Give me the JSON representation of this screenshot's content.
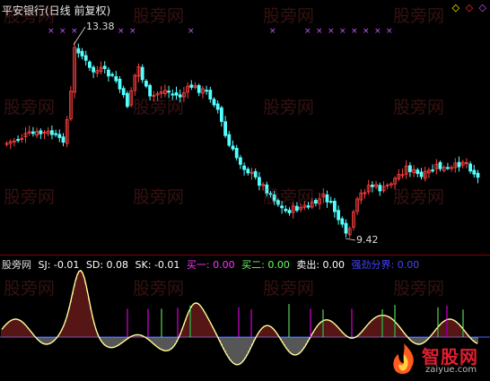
{
  "header": {
    "title": "平安银行(日线 前复权)"
  },
  "markers": {
    "glyphs": [
      "◇",
      "◇",
      "◇"
    ],
    "colors": [
      "#ffff00",
      "#ff3333",
      "#cc55ff"
    ]
  },
  "annotations": {
    "high": "13.38",
    "low": "9.42"
  },
  "indicator": {
    "name": "股旁网",
    "sj": "SJ: -0.01",
    "sd": "SD: 0.08",
    "sk": "SK: -0.01",
    "buy1": "买一: 0.00",
    "buy2": "买二: 0.00",
    "sell": "卖出: 0.00",
    "strong": "强劲分界: 0.00"
  },
  "watermark": "股旁网",
  "logo": {
    "text": "智股网",
    "url": "zaiyue.com"
  },
  "colors": {
    "up": "#ff4040",
    "down": "#54ffff",
    "neutral": "#ffffff",
    "magenta": "#ff00ff",
    "green": "#66ff66",
    "blue": "#3333ff",
    "yellow": "#ffff99",
    "gray": "#bbbbbb"
  }
}
